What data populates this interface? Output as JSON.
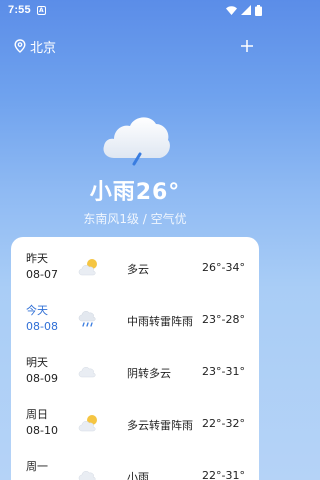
{
  "status_bar": {
    "time": "7:55",
    "badge": "A"
  },
  "header": {
    "city": "北京"
  },
  "current": {
    "title": "小雨26°",
    "subtitle": "东南风1级 / 空气优"
  },
  "forecast": [
    {
      "day": "昨天",
      "date": "08-07",
      "condition": "多云",
      "range": "26°-34°",
      "icon": "partly-cloudy-icon",
      "today": false
    },
    {
      "day": "今天",
      "date": "08-08",
      "condition": "中雨转雷阵雨",
      "range": "23°-28°",
      "icon": "rain-icon",
      "today": true
    },
    {
      "day": "明天",
      "date": "08-09",
      "condition": "阴转多云",
      "range": "23°-31°",
      "icon": "cloud-icon",
      "today": false
    },
    {
      "day": "周日",
      "date": "08-10",
      "condition": "多云转雷阵雨",
      "range": "22°-32°",
      "icon": "partly-cloudy-icon",
      "today": false
    },
    {
      "day": "周一",
      "date": "",
      "condition": "小雨",
      "range": "22°-31°",
      "icon": "cloud-icon",
      "today": false
    }
  ],
  "colors": {
    "accent_today": "#2f6fd6",
    "card_bg": "#ffffff"
  }
}
